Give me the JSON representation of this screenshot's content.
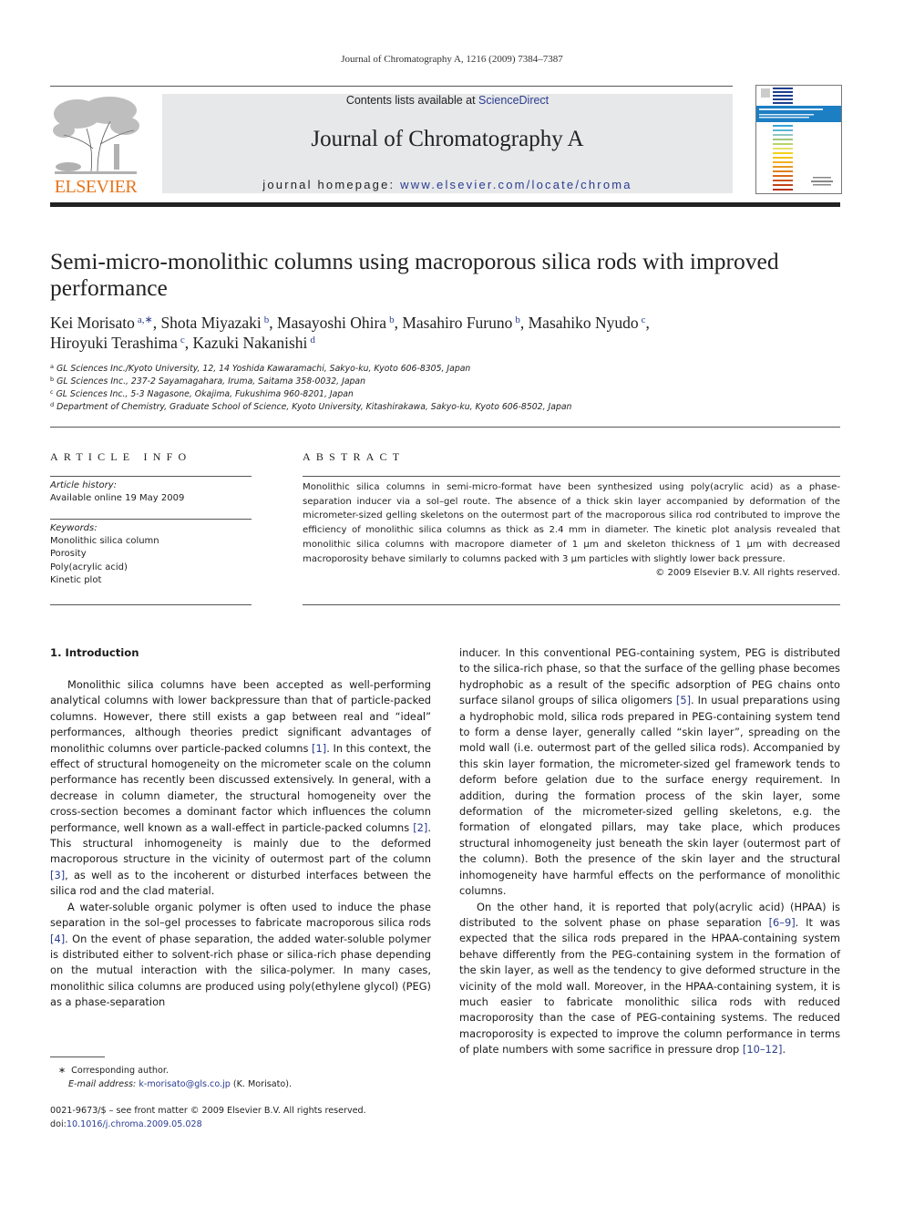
{
  "header": {
    "citation": "Journal of Chromatography A, 1216 (2009) 7384–7387",
    "contents_prefix": "Contents lists available at ",
    "contents_link": "ScienceDirect",
    "journal_title": "Journal of Chromatography A",
    "homepage_prefix": "journal homepage: ",
    "homepage_link": "www.elsevier.com/locate/chroma",
    "publisher_wordmark": "ELSEVIER",
    "colors": {
      "publisher_orange": "#e8751a",
      "link_blue": "#2a3d8f",
      "banner_gray": "#e7e8ea"
    }
  },
  "article": {
    "title": "Semi-micro-monolithic columns using macroporous silica rods with improved performance",
    "authors": [
      {
        "name": "Kei Morisato",
        "sup": "a,∗"
      },
      {
        "name": "Shota Miyazaki",
        "sup": "b"
      },
      {
        "name": "Masayoshi Ohira",
        "sup": "b"
      },
      {
        "name": "Masahiro Furuno",
        "sup": "b"
      },
      {
        "name": "Masahiko Nyudo",
        "sup": "c"
      },
      {
        "name": "Hiroyuki Terashima",
        "sup": "c"
      },
      {
        "name": "Kazuki Nakanishi",
        "sup": "d"
      }
    ],
    "affiliations": [
      {
        "sup": "a",
        "text": "GL Sciences Inc./Kyoto University, 12, 14 Yoshida Kawaramachi, Sakyo-ku, Kyoto 606-8305, Japan"
      },
      {
        "sup": "b",
        "text": "GL Sciences Inc., 237-2 Sayamagahara, Iruma, Saitama 358-0032, Japan"
      },
      {
        "sup": "c",
        "text": "GL Sciences Inc., 5-3 Nagasone, Okajima, Fukushima 960-8201, Japan"
      },
      {
        "sup": "d",
        "text": "Department of Chemistry, Graduate School of Science, Kyoto University, Kitashirakawa, Sakyo-ku, Kyoto 606-8502, Japan"
      }
    ]
  },
  "article_info": {
    "heading": "ARTICLE INFO",
    "history_label": "Article history:",
    "history_value": "Available online 19 May 2009",
    "keywords_label": "Keywords:",
    "keywords": [
      "Monolithic silica column",
      "Porosity",
      "Poly(acrylic acid)",
      "Kinetic plot"
    ]
  },
  "abstract": {
    "heading": "ABSTRACT",
    "text": "Monolithic silica columns in semi-micro-format have been synthesized using poly(acrylic acid) as a phase-separation inducer via a sol–gel route. The absence of a thick skin layer accompanied by deformation of the micrometer-sized gelling skeletons on the outermost part of the macroporous silica rod contributed to improve the efficiency of monolithic silica columns as thick as 2.4 mm in diameter. The kinetic plot analysis revealed that monolithic silica columns with macropore diameter of 1 μm and skeleton thickness of 1 μm with decreased macroporosity behave similarly to columns packed with 3 μm particles with slightly lower back pressure.",
    "copyright": "© 2009 Elsevier B.V. All rights reserved."
  },
  "body": {
    "section_title": "1.  Introduction",
    "left_paragraphs": [
      [
        {
          "t": "Monolithic silica columns have been accepted as well-performing analytical columns with lower backpressure than that of particle-packed columns. However, there still exists a gap between real and “ideal” performances, although theories predict significant advantages of monolithic columns over particle-packed columns "
        },
        {
          "ref": "[1]"
        },
        {
          "t": ". In this context, the effect of structural homogeneity on the micrometer scale on the column performance has recently been discussed extensively. In general, with a decrease in column diameter, the structural homogeneity over the cross-section becomes a dominant factor which influences the column performance, well known as a wall-effect in particle-packed columns "
        },
        {
          "ref": "[2]"
        },
        {
          "t": ". This structural inhomogeneity is mainly due to the deformed macroporous structure in the vicinity of outermost part of the column "
        },
        {
          "ref": "[3]"
        },
        {
          "t": ", as well as to the incoherent or disturbed interfaces between the silica rod and the clad material."
        }
      ],
      [
        {
          "t": "A water-soluble organic polymer is often used to induce the phase separation in the sol–gel processes to fabricate macroporous silica rods "
        },
        {
          "ref": "[4]"
        },
        {
          "t": ". On the event of phase separation, the added water-soluble polymer is distributed either to solvent-rich phase or silica-rich phase depending on the mutual interaction with the silica-polymer. In many cases, monolithic silica columns are produced using poly(ethylene glycol) (PEG) as a phase-separation"
        }
      ]
    ],
    "right_paragraphs": [
      [
        {
          "t": "inducer. In this conventional PEG-containing system, PEG is distributed to the silica-rich phase, so that the surface of the gelling phase becomes hydrophobic as a result of the specific adsorption of PEG chains onto surface silanol groups of silica oligomers "
        },
        {
          "ref": "[5]"
        },
        {
          "t": ". In usual preparations using a hydrophobic mold, silica rods prepared in PEG-containing system tend to form a dense layer, generally called “skin layer”, spreading on the mold wall (i.e. outermost part of the gelled silica rods). Accompanied by this skin layer formation, the micrometer-sized gel framework tends to deform before gelation due to the surface energy requirement. In addition, during the formation process of the skin layer, some deformation of the micrometer-sized gelling skeletons, e.g. the formation of elongated pillars, may take place, which produces structural inhomogeneity just beneath the skin layer (outermost part of the column). Both the presence of the skin layer and the structural inhomogeneity have harmful effects on the performance of monolithic columns."
        }
      ],
      [
        {
          "t": "On the other hand, it is reported that poly(acrylic acid) (HPAA) is distributed to the solvent phase on phase separation "
        },
        {
          "ref": "[6–9]"
        },
        {
          "t": ". It was expected that the silica rods prepared in the HPAA-containing system behave differently from the PEG-containing system in the formation of the skin layer, as well as the tendency to give deformed structure in the vicinity of the mold wall. Moreover, in the HPAA-containing system, it is much easier to fabricate monolithic silica rods with reduced macroporosity than the case of PEG-containing systems. The reduced macroporosity is expected to improve the column performance in terms of plate numbers with some sacrifice in pressure drop "
        },
        {
          "ref": "[10–12]"
        },
        {
          "t": "."
        }
      ]
    ]
  },
  "footnotes": {
    "corresponding_marker": "∗",
    "corresponding_text": "Corresponding author.",
    "email_label": "E-mail address: ",
    "email": "k-morisato@gls.co.jp",
    "email_suffix": " (K. Morisato).",
    "front_matter": "0021-9673/$ – see front matter © 2009 Elsevier B.V. All rights reserved.",
    "doi_label": "doi:",
    "doi": "10.1016/j.chroma.2009.05.028"
  }
}
